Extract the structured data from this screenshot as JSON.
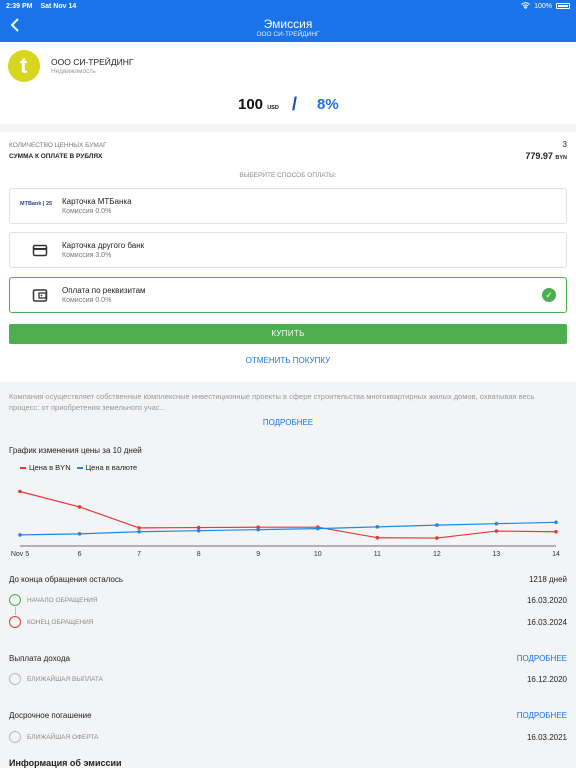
{
  "status_bar": {
    "time": "2:39 PM",
    "date": "Sat Nov 14",
    "battery": "100%"
  },
  "header": {
    "title": "Эмиссия",
    "subtitle": "ООО СИ-ТРЕЙДИНГ"
  },
  "company": {
    "logo_letter": "t",
    "name": "ООО СИ-ТРЕЙДИНГ",
    "sector": "Недвижимость",
    "logo_color": "#d8d61f"
  },
  "price": {
    "amount": "100",
    "currency": "USD",
    "separator": "/",
    "rate": "8%"
  },
  "order": {
    "qty_label": "КОЛИЧЕСТВО ЦЕННЫХ БУМАГ",
    "qty_value": "3",
    "sum_label": "СУММА К ОПЛАТЕ В РУБЛЯХ",
    "sum_value": "779.97",
    "sum_currency": "BYN",
    "choose_label": "ВЫБЕРИТЕ СПОСОБ ОПЛАТЫ:",
    "methods": [
      {
        "name": "Карточка МТБанка",
        "fee": "Комиссия 0.0%",
        "icon": "mtbank-logo",
        "icon_text": "MTBank | 25"
      },
      {
        "name": "Карточка другого банк",
        "fee": "Комиссия 3.0%",
        "icon": "card-icon"
      },
      {
        "name": "Оплата по реквизитам",
        "fee": "Комиссия 0.0%",
        "icon": "wallet-icon",
        "selected": true
      }
    ],
    "buy_label": "КУПИТЬ",
    "cancel_label": "ОТМЕНИТЬ ПОКУПКУ"
  },
  "description": {
    "text": "Компания осуществляет собственные комплексные инвестиционные проекты в сфере строительства многоквартирных жилых домов, охватывая весь процесс: от приобретения земельного учас...",
    "more_label": "ПОДРОБНЕЕ"
  },
  "chart_data": {
    "type": "line",
    "title": "График изменения цены за 10 дней",
    "categories": [
      "Nov 5",
      "6",
      "7",
      "8",
      "9",
      "10",
      "11",
      "12",
      "13",
      "14"
    ],
    "series": [
      {
        "name": "Цена в BYN",
        "color": "#e53935",
        "values": [
          100.0,
          95.6,
          89.6,
          89.7,
          89.8,
          89.8,
          86.8,
          86.7,
          88.7,
          88.5
        ]
      },
      {
        "name": "Цена в валюте",
        "color": "#1e88e5",
        "values": [
          87.6,
          87.9,
          88.5,
          88.8,
          89.1,
          89.4,
          89.9,
          90.4,
          90.8,
          91.2
        ]
      }
    ],
    "ylim": [
      85.0,
      101.0
    ],
    "grid": false,
    "legend": "top-left"
  },
  "circulation": {
    "label": "До конца обращения осталось",
    "value": "1218 дней",
    "start_label": "НАЧАЛО ОБРАЩЕНИЯ",
    "start_date": "16.03.2020",
    "end_label": "КОНЕЦ ОБРАЩЕНИЯ",
    "end_date": "16.03.2024"
  },
  "income": {
    "label": "Выплата дохода",
    "link": "ПОДРОБНЕЕ",
    "next_label": "БЛИЖАЙШАЯ ВЫПЛАТА",
    "next_date": "16.12.2020"
  },
  "redemption": {
    "label": "Досрочное погашение",
    "link": "ПОДРОБНЕЕ",
    "next_label": "БЛИЖАЙШАЯ ОФЕРТА",
    "next_date": "16.03.2021"
  },
  "emission_info": {
    "title": "Информация об эмиссии"
  }
}
